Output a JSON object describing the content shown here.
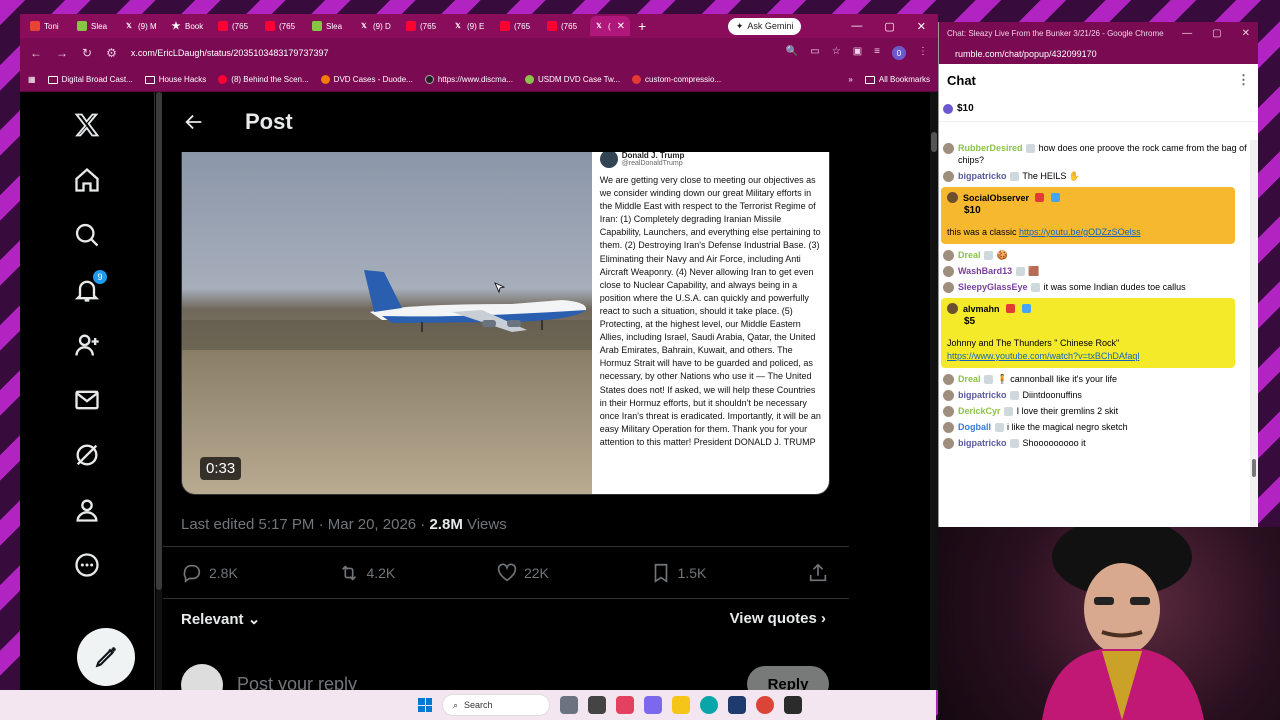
{
  "browser": {
    "tabs": [
      {
        "label": "Toni",
        "icon": "gm"
      },
      {
        "label": "Slea",
        "icon": "rb"
      },
      {
        "label": "(9) M",
        "icon": "x"
      },
      {
        "label": "Book",
        "icon": "star"
      },
      {
        "label": "(765",
        "icon": "yt"
      },
      {
        "label": "(765",
        "icon": "yt"
      },
      {
        "label": "Slea",
        "icon": "rb"
      },
      {
        "label": "(9) D",
        "icon": "x"
      },
      {
        "label": "(765",
        "icon": "yt"
      },
      {
        "label": "(9) E",
        "icon": "x"
      },
      {
        "label": "(765",
        "icon": "yt"
      },
      {
        "label": "(765",
        "icon": "yt"
      },
      {
        "label": "(",
        "icon": "x",
        "active": true
      }
    ],
    "new_tab": "+",
    "gemini_label": "Ask Gemini",
    "url": "x.com/EricLDaugh/status/2035103483179737397",
    "bookmarks": [
      "Digital Broad Cast...",
      "House Hacks",
      "(8) Behind the Scen...",
      "DVD Cases - Duode...",
      "https://www.discma...",
      "USDM DVD Case Tw...",
      "custom-compressio..."
    ],
    "bookmarks_more": "»",
    "all_bookmarks": "All Bookmarks"
  },
  "x": {
    "notification_count": "9",
    "header_title": "Post",
    "video_duration": "0:33",
    "truth": {
      "name": "Donald J. Trump",
      "handle": "@realDonaldTrump",
      "body": "We are getting very close to meeting our objectives as we consider winding down our great Military efforts in the Middle East with respect to the Terrorist Regime of Iran: (1) Completely degrading Iranian Missile Capability, Launchers, and everything else pertaining to them. (2) Destroying Iran's Defense Industrial Base. (3) Eliminating their Navy and Air Force, including Anti Aircraft Weaponry. (4) Never allowing Iran to get even close to Nuclear Capability, and always being in a position where the U.S.A. can quickly and powerfully react to such a situation, should it take place. (5) Protecting, at the highest level, our Middle Eastern Allies, including Israel, Saudi Arabia, Qatar, the United Arab Emirates, Bahrain, Kuwait, and others. The Hormuz Strait will have to be guarded and policed, as necessary, by other Nations who use it — The United States does not! If asked, we will help these Countries in their Hormuz efforts, but it shouldn't be necessary once Iran's threat is eradicated. Importantly, it will be an easy Military Operation for them. Thank you for your attention to this matter! President DONALD J. TRUMP"
    },
    "meta_edited": "Last edited 5:17 PM · Mar 20, 2026 · ",
    "meta_views": "2.8M",
    "meta_views_label": " Views",
    "actions": {
      "replies": "2.8K",
      "reposts": "4.2K",
      "likes": "22K",
      "bookmarks": "1.5K"
    },
    "sort_label": "Relevant",
    "view_quotes": "View quotes",
    "reply_placeholder": "Post your reply",
    "reply_button": "Reply"
  },
  "taskbar": {
    "search": "Search"
  },
  "chat": {
    "window_title": "Chat: Sleazy Live From the Bunker 3/21/26 - Google Chrome",
    "url": "rumble.com/chat/popup/432099170",
    "header": "Chat",
    "pinned_amount": "$10",
    "messages": [
      {
        "type": "msg",
        "user": "RubberDesired",
        "color": "#8bc34a",
        "text": "how does one proove the rock came from the bag of chips?"
      },
      {
        "type": "msg",
        "user": "bigpatricko",
        "color": "#5a5aa0",
        "text": "The HEILS ✋"
      },
      {
        "type": "rant",
        "user": "SocialObserver",
        "amount": "$10",
        "bg": "#f5b82e",
        "text": "this was a classic ",
        "link": "https://youtu.be/gODZzSOelss"
      },
      {
        "type": "msg",
        "user": "Dreal",
        "color": "#8bc34a",
        "text": "🍪"
      },
      {
        "type": "msg",
        "user": "WashBard13",
        "color": "#7a3fa0",
        "text": "🟫"
      },
      {
        "type": "msg",
        "user": "SleepyGlassEye",
        "color": "#7a3fa0",
        "text": "it was some Indian dudes toe callus"
      },
      {
        "type": "rant",
        "user": "alvmahn",
        "amount": "$5",
        "bg": "#f4ea2a",
        "text": "Johnny and The Thunders \" Chinese Rock\" ",
        "link": "https://www.youtube.com/watch?v=txBChDAfaql"
      },
      {
        "type": "msg",
        "user": "Dreal",
        "color": "#8bc34a",
        "text": "🧍 cannonball like it's your life"
      },
      {
        "type": "msg",
        "user": "bigpatricko",
        "color": "#5a5aa0",
        "text": "Diintdoonuffins"
      },
      {
        "type": "msg",
        "user": "DerickCyr",
        "color": "#8bc34a",
        "text": "I love their gremlins 2 skit"
      },
      {
        "type": "msg",
        "user": "Dogball",
        "color": "#3a7bd5",
        "text": "i like the magical negro sketch"
      },
      {
        "type": "msg",
        "user": "bigpatricko",
        "color": "#5a5aa0",
        "text": "Shooooooooo it"
      }
    ]
  }
}
